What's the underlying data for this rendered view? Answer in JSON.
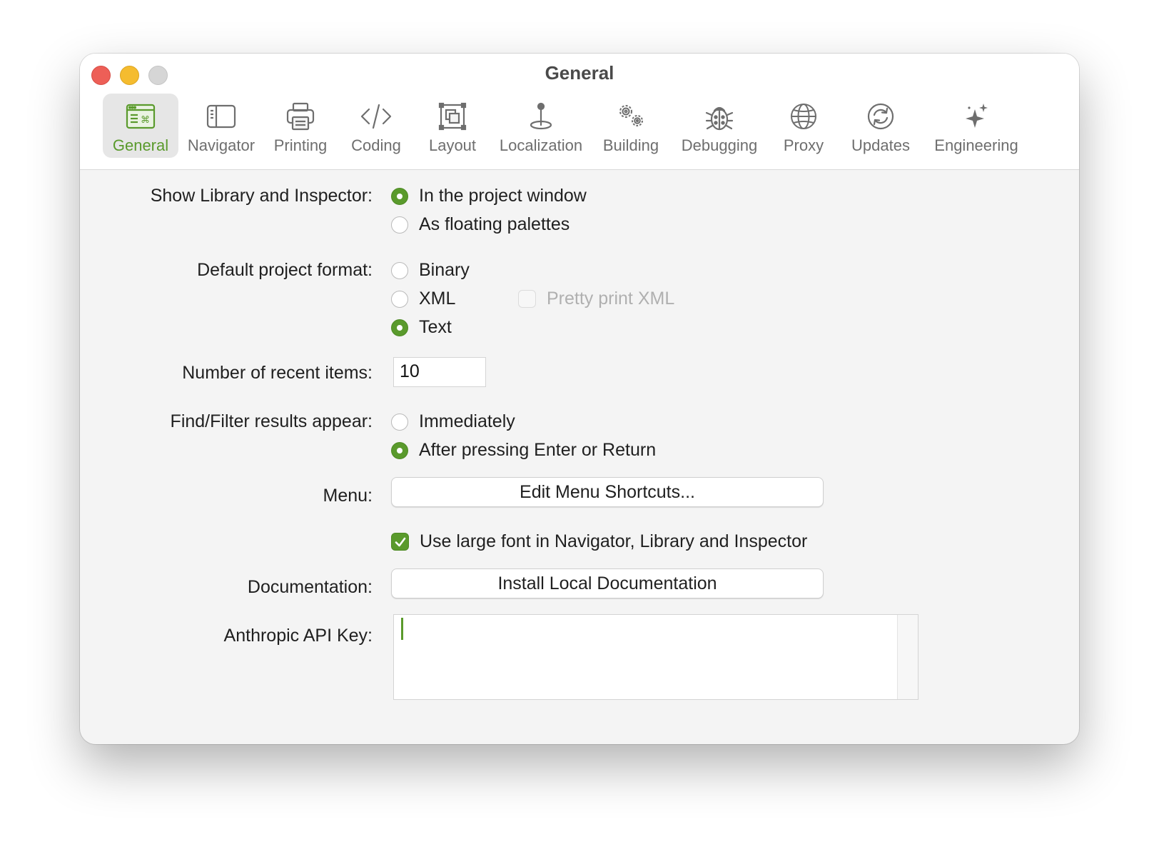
{
  "window": {
    "title": "General"
  },
  "toolbar": {
    "items": [
      {
        "label": "General",
        "icon": "general-icon",
        "active": true
      },
      {
        "label": "Navigator",
        "icon": "navigator-icon"
      },
      {
        "label": "Printing",
        "icon": "printer-icon"
      },
      {
        "label": "Coding",
        "icon": "code-icon"
      },
      {
        "label": "Layout",
        "icon": "layout-icon"
      },
      {
        "label": "Localization",
        "icon": "pin-icon"
      },
      {
        "label": "Building",
        "icon": "gears-icon"
      },
      {
        "label": "Debugging",
        "icon": "bug-icon"
      },
      {
        "label": "Proxy",
        "icon": "globe-icon"
      },
      {
        "label": "Updates",
        "icon": "refresh-icon"
      },
      {
        "label": "Engineering",
        "icon": "sparkles-icon"
      }
    ]
  },
  "settings": {
    "library_inspector": {
      "label": "Show Library and Inspector:",
      "options": [
        "In the project window",
        "As floating palettes"
      ],
      "selected": "In the project window"
    },
    "project_format": {
      "label": "Default project format:",
      "options": [
        "Binary",
        "XML",
        "Text"
      ],
      "selected": "Text",
      "pretty_print_label": "Pretty print XML",
      "pretty_print_checked": false,
      "pretty_print_enabled": false
    },
    "recent_items": {
      "label": "Number of recent items:",
      "value": "10"
    },
    "find_filter": {
      "label": "Find/Filter results appear:",
      "options": [
        "Immediately",
        "After pressing Enter or Return"
      ],
      "selected": "After pressing Enter or Return"
    },
    "menu": {
      "label": "Menu:",
      "button_label": "Edit Menu Shortcuts..."
    },
    "large_font": {
      "label": "Use large font in Navigator, Library and Inspector",
      "checked": true
    },
    "documentation": {
      "label": "Documentation:",
      "button_label": "Install Local Documentation"
    },
    "api_key": {
      "label": "Anthropic API Key:",
      "value": ""
    }
  },
  "colors": {
    "accent": "#5a9a2c",
    "close": "#ed5f57",
    "minimize": "#f5bc2f",
    "zoom": "#d6d6d6"
  }
}
